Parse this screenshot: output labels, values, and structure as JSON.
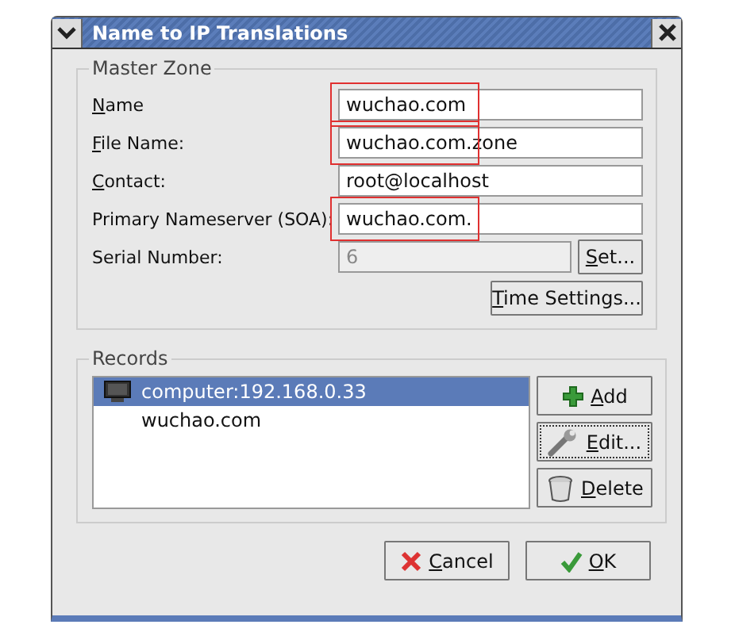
{
  "window": {
    "title": "Name to IP Translations"
  },
  "master_zone": {
    "title": "Master Zone",
    "fields": [
      {
        "label": "Name",
        "underline_first": true,
        "value": "wuchao.com",
        "disabled": false,
        "highlighted": true
      },
      {
        "label": "File Name:",
        "underline_first": true,
        "value": "wuchao.com.zone",
        "disabled": false,
        "highlighted": true
      },
      {
        "label": "Contact:",
        "underline_first": true,
        "value": "root@localhost",
        "disabled": false,
        "highlighted": false
      },
      {
        "label": "Primary Nameserver (SOA):",
        "underline_first": false,
        "value": "wuchao.com.",
        "disabled": false,
        "highlighted": true
      },
      {
        "label": "Serial Number:",
        "underline_first": false,
        "value": "6",
        "disabled": true,
        "highlighted": false,
        "button": "Set..."
      }
    ],
    "time_button": "Time Settings..."
  },
  "records": {
    "title": "Records",
    "items": [
      {
        "label": "computer:192.168.0.33",
        "selected": true,
        "kind": "computer"
      },
      {
        "label": "wuchao.com",
        "selected": false,
        "kind": "plain"
      }
    ],
    "buttons": [
      {
        "label": "Add",
        "kind": "add"
      },
      {
        "label": "Edit...",
        "kind": "edit"
      },
      {
        "label": "Delete",
        "kind": "delete"
      }
    ]
  },
  "buttons": [
    {
      "label": "Cancel",
      "kind": "cancel"
    },
    {
      "label": "OK",
      "kind": "ok"
    }
  ]
}
